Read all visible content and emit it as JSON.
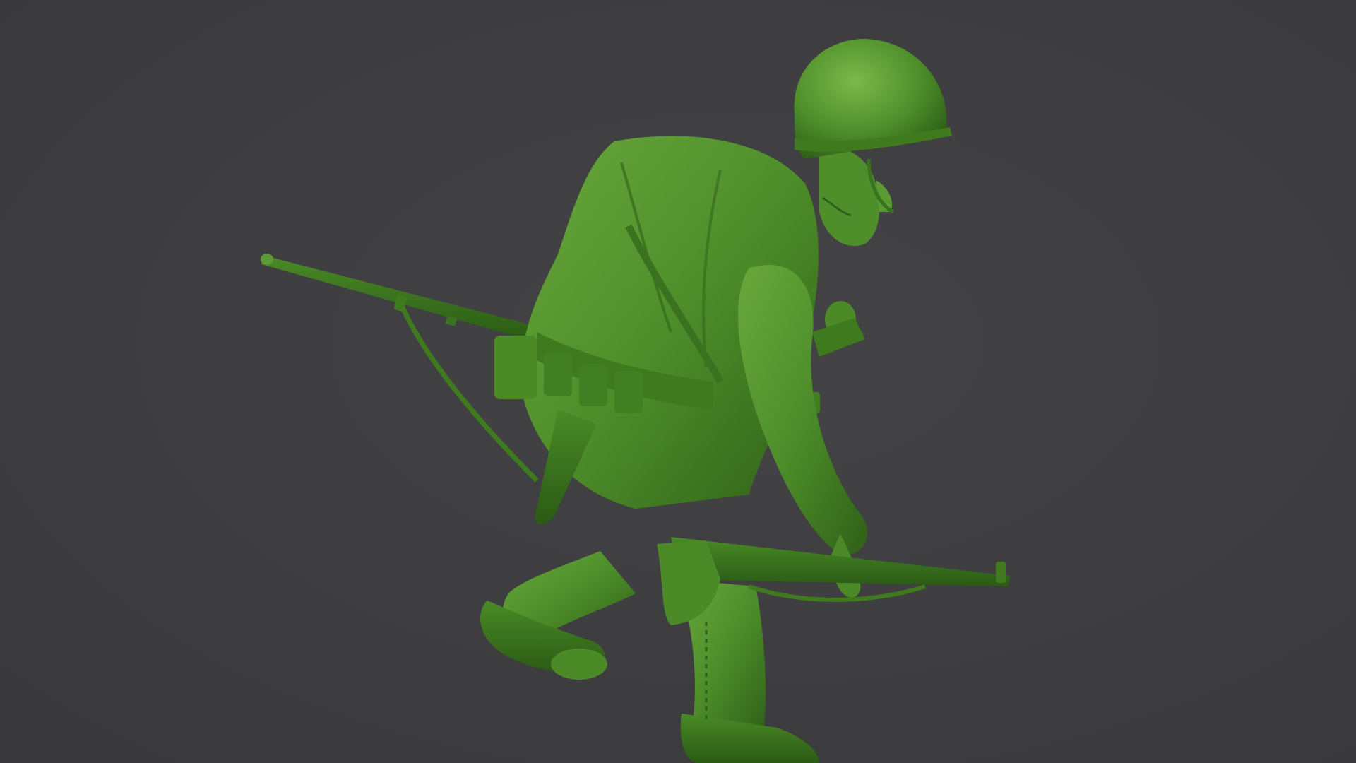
{
  "scene": {
    "subject_icon": "toy-soldier-figure",
    "background_color": "#3e3e40",
    "model_color": "#4f8f2c",
    "model_shadow_color": "#2f5f17",
    "model_highlight_color": "#79b44a"
  }
}
